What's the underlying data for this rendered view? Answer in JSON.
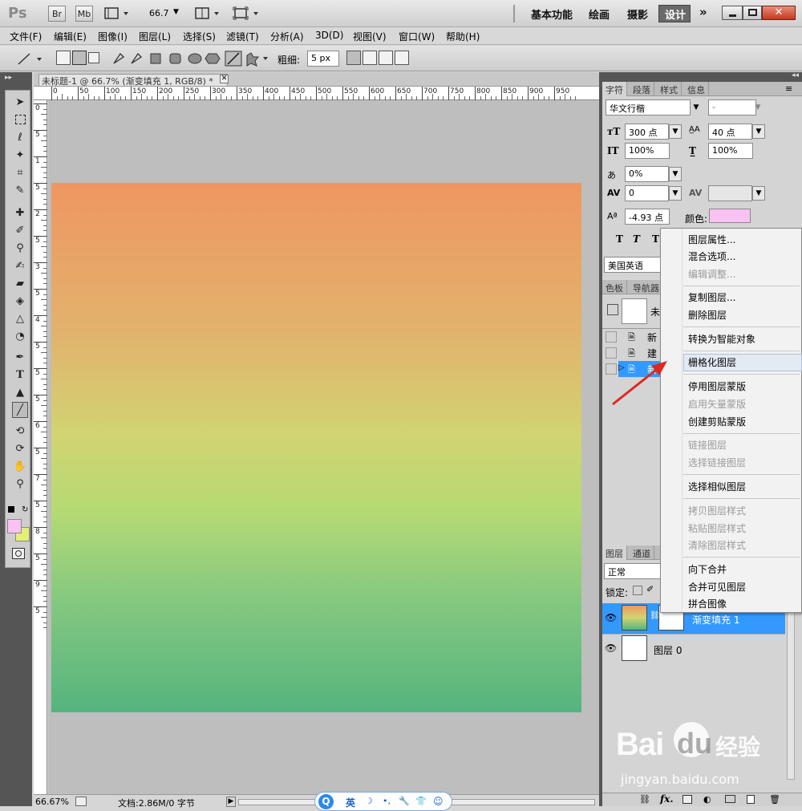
{
  "titlebar": {
    "ps_logo": "Ps",
    "br": "Br",
    "mb": "Mb",
    "zoom": "66.7",
    "workspaces": [
      "基本功能",
      "绘画",
      "摄影",
      "设计"
    ],
    "more": "»"
  },
  "menubar": [
    "文件(F)",
    "编辑(E)",
    "图像(I)",
    "图层(L)",
    "选择(S)",
    "滤镜(T)",
    "分析(A)",
    "3D(D)",
    "视图(V)",
    "窗口(W)",
    "帮助(H)"
  ],
  "options": {
    "weight_label": "粗细:",
    "weight_value": "5 px"
  },
  "document": {
    "tab_title": "未标题-1 @ 66.7% (渐变填充 1, RGB/8) *",
    "ruler_h": [
      "0",
      "50",
      "100",
      "150",
      "200",
      "250",
      "300",
      "350",
      "400",
      "450",
      "500",
      "550",
      "600",
      "650",
      "700",
      "750",
      "800",
      "850",
      "900",
      "950"
    ],
    "ruler_v": [
      "0",
      "5",
      "1",
      "5",
      "2",
      "5",
      "3",
      "5",
      "4",
      "5",
      "5",
      "5",
      "6",
      "5",
      "7",
      "5",
      "8",
      "5",
      "9",
      "5"
    ],
    "gradient_colors": [
      "#ef9661",
      "#d1d472",
      "#55b47e"
    ]
  },
  "status": {
    "zoom": "66.67%",
    "doc": "文档:2.86M/0 字节"
  },
  "character_panel": {
    "tabs": [
      "字符",
      "段落",
      "样式",
      "信息"
    ],
    "font": "华文行楷",
    "style": "-",
    "size": "300 点",
    "leading": "40 点",
    "v_scale": "100%",
    "h_scale": "100%",
    "tracking": "0%",
    "kerning": "0",
    "baseline": "-4.93 点",
    "color_label": "颜色:",
    "color": "#f9c2f2",
    "language": "美国英语",
    "tt_buttons": [
      "T",
      "T",
      "T"
    ]
  },
  "history_panel": {
    "tabs": [
      "色板",
      "导航器"
    ],
    "snapshot": "未",
    "items": [
      "新",
      "建",
      "新"
    ]
  },
  "context_menu": {
    "items": [
      {
        "label": "图层属性...",
        "disabled": false
      },
      {
        "label": "混合选项...",
        "disabled": false
      },
      {
        "label": "编辑调整...",
        "disabled": true
      },
      {
        "label": "复制图层...",
        "disabled": false
      },
      {
        "label": "删除图层",
        "disabled": false
      },
      {
        "label": "转换为智能对象",
        "disabled": false
      },
      {
        "label": "栅格化图层",
        "disabled": false,
        "highlighted": true
      },
      {
        "label": "停用图层蒙版",
        "disabled": false
      },
      {
        "label": "启用矢量蒙版",
        "disabled": true
      },
      {
        "label": "创建剪贴蒙版",
        "disabled": false
      },
      {
        "label": "链接图层",
        "disabled": true
      },
      {
        "label": "选择链接图层",
        "disabled": true
      },
      {
        "label": "选择相似图层",
        "disabled": false
      },
      {
        "label": "拷贝图层样式",
        "disabled": true
      },
      {
        "label": "粘贴图层样式",
        "disabled": true
      },
      {
        "label": "清除图层样式",
        "disabled": true
      },
      {
        "label": "向下合并",
        "disabled": false
      },
      {
        "label": "合并可见图层",
        "disabled": false
      },
      {
        "label": "拼合图像",
        "disabled": false
      }
    ]
  },
  "layers_panel": {
    "tabs": [
      "图层",
      "通道"
    ],
    "blend_mode": "正常",
    "lock_label": "锁定:",
    "layers": [
      {
        "name": "渐变填充 1",
        "selected": true
      },
      {
        "name": "图层 0",
        "selected": false
      }
    ],
    "bottom_icons": [
      "link-icon",
      "fx-icon",
      "mask-icon",
      "adjustment-icon",
      "folder-icon",
      "new-layer-icon",
      "trash-icon"
    ]
  },
  "watermark": {
    "brand": "Bai",
    "brand2": "du",
    "cn": "经验",
    "url": "jingyan.baidu.com"
  },
  "ime": {
    "lang": "英"
  }
}
